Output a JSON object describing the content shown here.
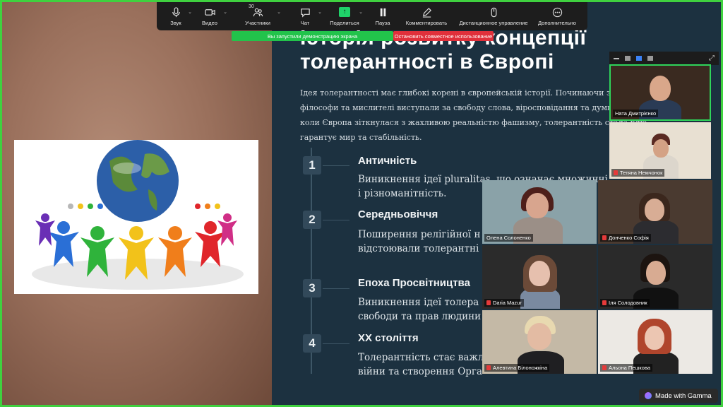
{
  "toolbar": {
    "items": [
      {
        "label": "Звук",
        "icon": "microphone-icon"
      },
      {
        "label": "Видео",
        "icon": "camera-icon"
      },
      {
        "label": "Участники",
        "icon": "participants-icon",
        "count": "30"
      },
      {
        "label": "Чат",
        "icon": "chat-icon"
      },
      {
        "label": "Поделиться",
        "icon": "share-screen-icon"
      },
      {
        "label": "Пауза",
        "icon": "pause-icon"
      },
      {
        "label": "Комментировать",
        "icon": "annotate-icon"
      },
      {
        "label": "Дистанционное управление",
        "icon": "remote-control-icon"
      },
      {
        "label": "Дополнительно",
        "icon": "more-icon"
      }
    ]
  },
  "share_banner": {
    "text": "Вы запустили демонстрацию экрана",
    "stop_label": "Остановить совместное использование"
  },
  "slide": {
    "title_line1": "Історія розвитку концепції",
    "title_line2": "толерантності в Європі",
    "intro_lines": [
      "Ідея толерантності має глибокі корені в європейській історії. Починаючи з епохи Пр",
      "філософи та мислителі виступали за свободу слова, віросповідання та думки. Після",
      "коли Європа зіткнулася з жахливою реальністю фашизму, толерантність стала клю",
      "гарантує мир та стабільність."
    ],
    "timeline": [
      {
        "num": "1",
        "era": "Античність",
        "lines": [
          "Виникнення ідеї pluralitas, що означає множинні",
          " і різноманітність."
        ]
      },
      {
        "num": "2",
        "era": "Середньовіччя",
        "lines": [
          "Поширення релігійної н",
          "відстоювали толерантні"
        ]
      },
      {
        "num": "3",
        "era": "Епоха Просвітництва",
        "lines": [
          "Виникнення ідеї толера",
          "свободи та прав людини"
        ]
      },
      {
        "num": "4",
        "era": "XX століття",
        "lines": [
          "Толерантність стає важл",
          "війни та створення Орга"
        ]
      }
    ]
  },
  "participants": [
    {
      "name": "Ната Дмитрієнко",
      "muted": false,
      "active": true
    },
    {
      "name": "Тетяна Немчонок",
      "muted": true
    },
    {
      "name": "Олена Солоненко",
      "muted": false
    },
    {
      "name": "Донченко Софія",
      "muted": true
    },
    {
      "name": "Daria Mazur",
      "muted": true
    },
    {
      "name": "Іля Солодовник",
      "muted": true
    },
    {
      "name": "Алевтина Білоножкіна",
      "muted": true
    },
    {
      "name": "Альона Пешкова",
      "muted": true
    }
  ],
  "gamma_badge": "Made with Gamma",
  "colors": {
    "accent_green": "#22c34b",
    "stop_red": "#e0303b",
    "slide_bg": "#1c3140",
    "share_green": "#1fd169"
  }
}
